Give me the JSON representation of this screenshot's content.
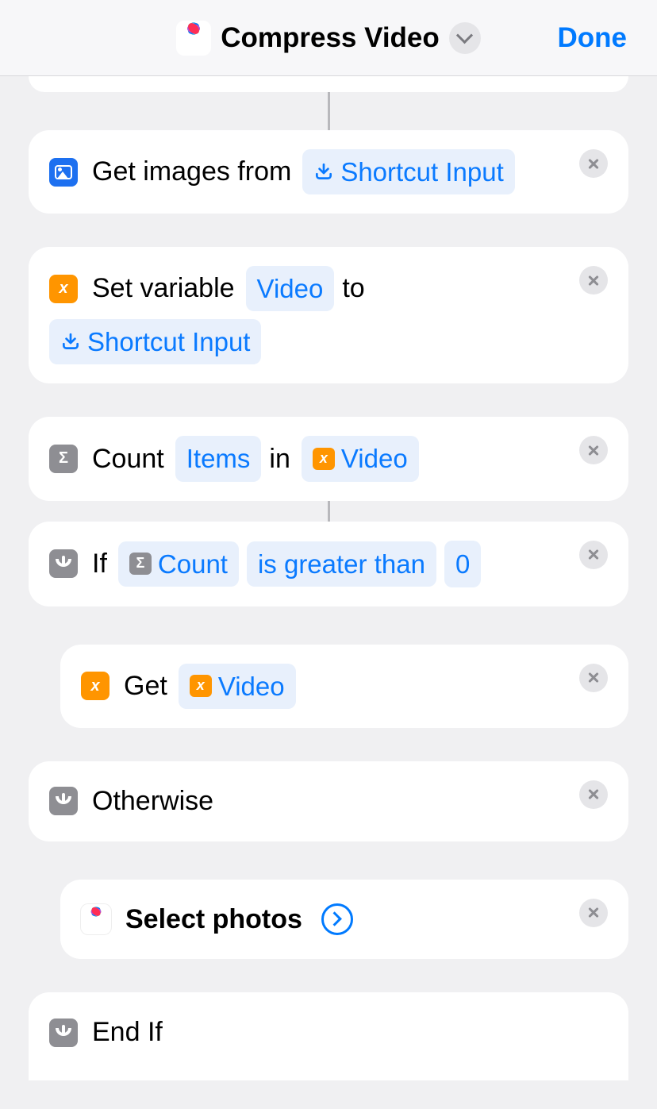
{
  "header": {
    "title": "Compress Video",
    "done": "Done"
  },
  "actions": {
    "getImages": {
      "label": "Get images from",
      "param": "Shortcut Input"
    },
    "setVariable": {
      "label1": "Set variable",
      "varName": "Video",
      "label2": "to",
      "param": "Shortcut Input"
    },
    "count": {
      "label1": "Count",
      "t1": "Items",
      "label2": "in",
      "t2": "Video"
    },
    "if": {
      "label": "If",
      "varName": "Count",
      "op": "is greater than",
      "val": "0"
    },
    "getVar": {
      "label": "Get",
      "varName": "Video"
    },
    "otherwise": "Otherwise",
    "selectPhotos": "Select photos",
    "endIf": "End If"
  }
}
